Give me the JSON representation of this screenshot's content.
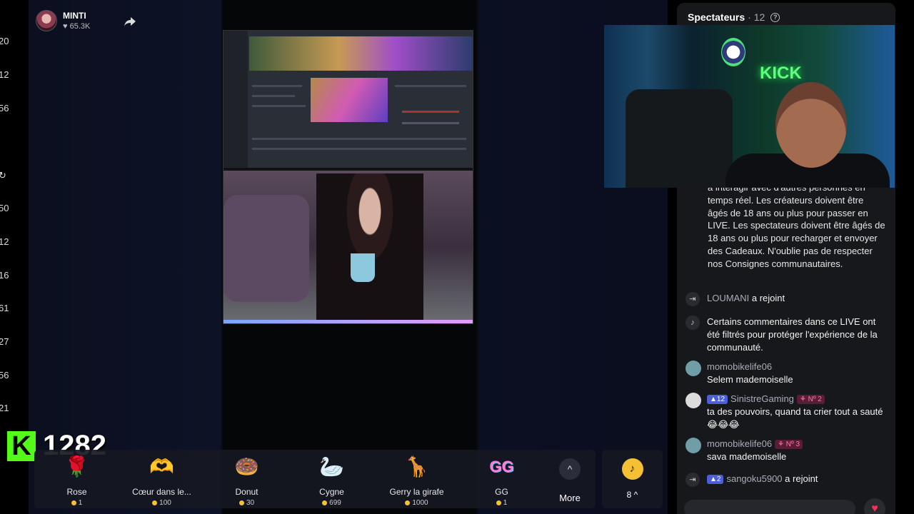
{
  "edge_numbers": [
    "20",
    "12",
    "56",
    "50",
    "12",
    "16",
    "61",
    "27",
    "56",
    "21"
  ],
  "host": {
    "name": "MINTI",
    "likes": "65.3K"
  },
  "kick": {
    "count": "1282",
    "logo_letter": "K"
  },
  "gifts": [
    {
      "name": "Rose",
      "price": "1",
      "icon": "🌹"
    },
    {
      "name": "Cœur dans le...",
      "price": "100",
      "icon": "🫶"
    },
    {
      "name": "Donut",
      "price": "30",
      "icon": "🍩"
    },
    {
      "name": "Cygne",
      "price": "699",
      "icon": "🦢"
    },
    {
      "name": "Gerry la girafe",
      "price": "1000",
      "icon": "🦒"
    },
    {
      "name": "GG",
      "price": "1",
      "icon": "GG"
    }
  ],
  "more_label": "More",
  "tiktok_count": "8 ^",
  "chat": {
    "title": "Spectateurs",
    "viewer_count": "· 12",
    "system_text": "a interagir avec d'autres personnes en temps réel. Les créateurs doivent être âgés de 18 ans ou plus pour passer en LIVE. Les spectateurs doivent être âgés de 18 ans ou plus pour recharger et envoyer des Cadeaux. N'oublie pas de respecter nos Consignes communautaires.",
    "joined_1": {
      "user": "LOUMANI",
      "text": "a rejoint"
    },
    "filter_notice": "Certains commentaires dans ce LIVE ont été filtrés pour protéger l'expérience de la communauté.",
    "messages": [
      {
        "user": "momobikelife06",
        "text": "Selem mademoiselle"
      },
      {
        "user": "SinistreGaming",
        "level": "12",
        "rank": "Nº 2",
        "text": "ta des pouvoirs, quand ta crier tout a sauté 😂😂😂"
      },
      {
        "user": "momobikelife06",
        "rank": "Nº 3",
        "text": "sava mademoiselle"
      }
    ],
    "joined_2": {
      "user": "sangoku5900",
      "level": "2",
      "text": "a rejoint"
    }
  },
  "colors": {
    "kick_green": "#53fc18",
    "coin": "#f5c033",
    "heart": "#ff2d55"
  }
}
